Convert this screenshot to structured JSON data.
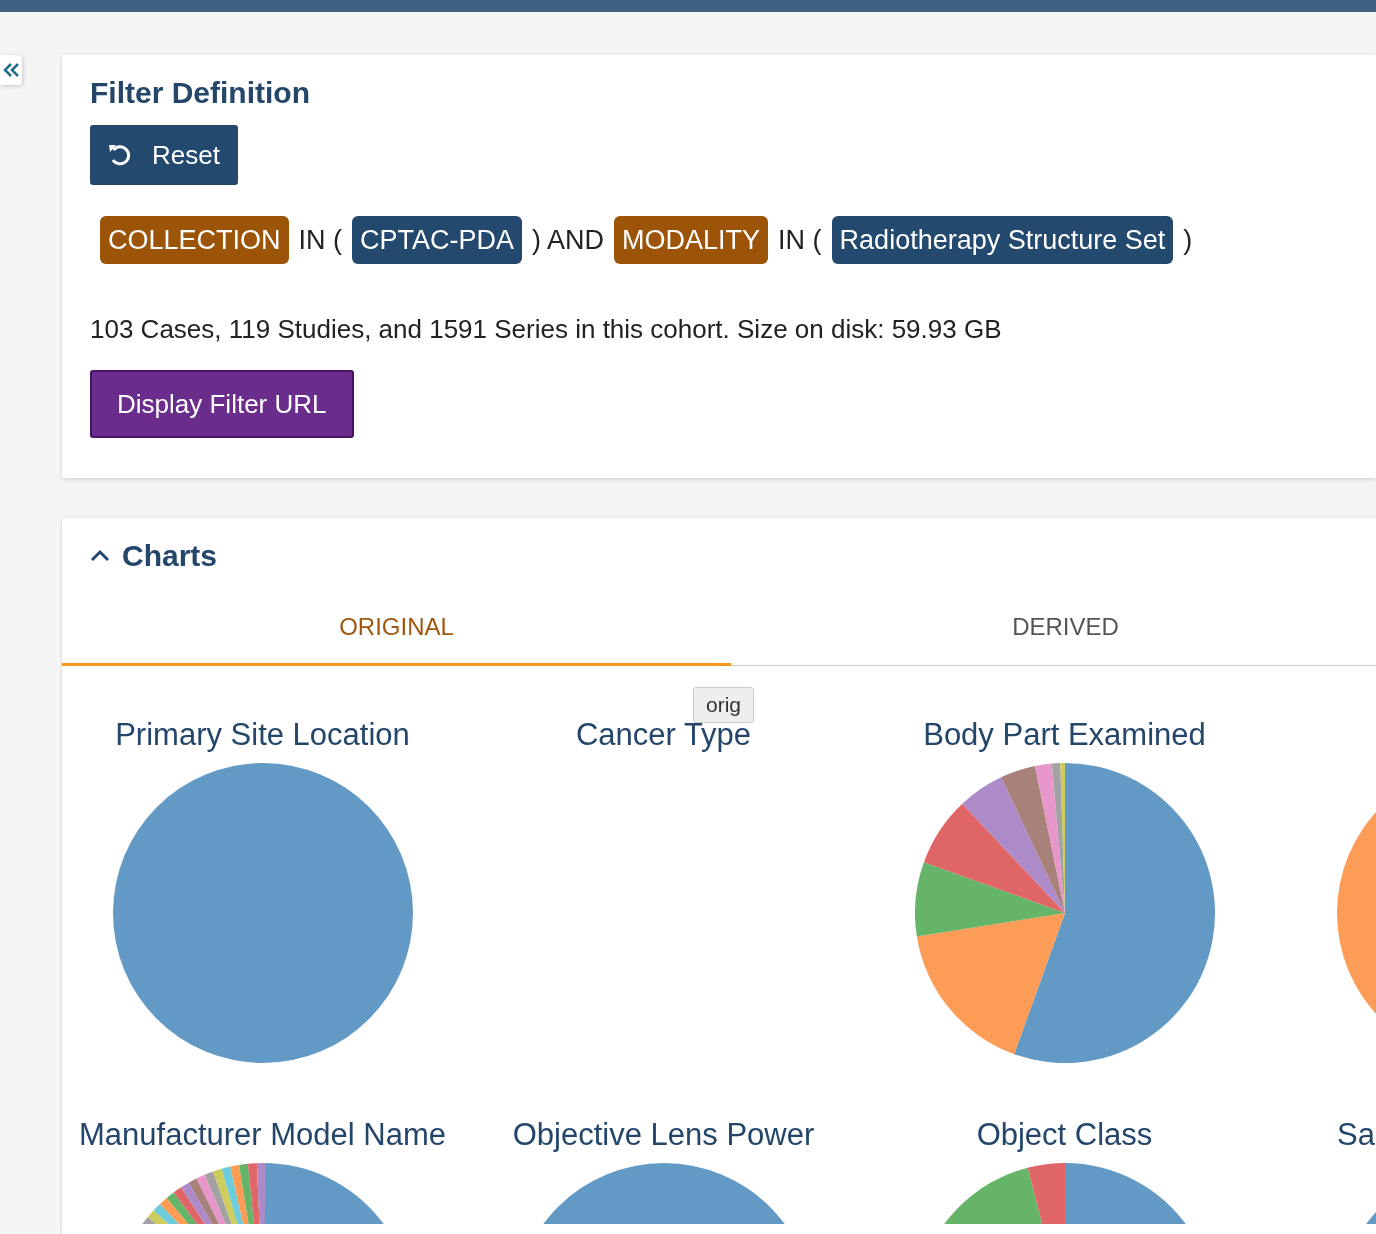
{
  "filter": {
    "title": "Filter Definition",
    "reset_button": "Reset",
    "query": [
      {
        "kind": "field",
        "text": "COLLECTION"
      },
      {
        "kind": "text",
        "text": "IN ("
      },
      {
        "kind": "value",
        "text": "CPTAC-PDA"
      },
      {
        "kind": "text",
        "text": ") AND"
      },
      {
        "kind": "field",
        "text": "MODALITY"
      },
      {
        "kind": "text",
        "text": "IN ("
      },
      {
        "kind": "value",
        "text": "Radiotherapy Structure Set"
      },
      {
        "kind": "text",
        "text": ")"
      }
    ],
    "summary": "103 Cases, 119 Studies, and 1591 Series in this cohort. Size on disk: 59.93 GB",
    "display_url_button": "Display Filter URL"
  },
  "charts": {
    "title": "Charts",
    "expanded": true,
    "tabs": [
      {
        "label": "ORIGINAL",
        "selected": true
      },
      {
        "label": "DERIVED",
        "selected": false
      }
    ],
    "panels": [
      {
        "title": "Primary Site Location"
      },
      {
        "title": "Cancer Type"
      },
      {
        "title": "Body Part Examined"
      },
      {
        "title": "Manufacturer Model Name"
      },
      {
        "title": "Objective Lens Power"
      },
      {
        "title": "Object Class"
      },
      {
        "title": "Sa"
      }
    ],
    "tooltip": {
      "text": "orig"
    }
  }
}
